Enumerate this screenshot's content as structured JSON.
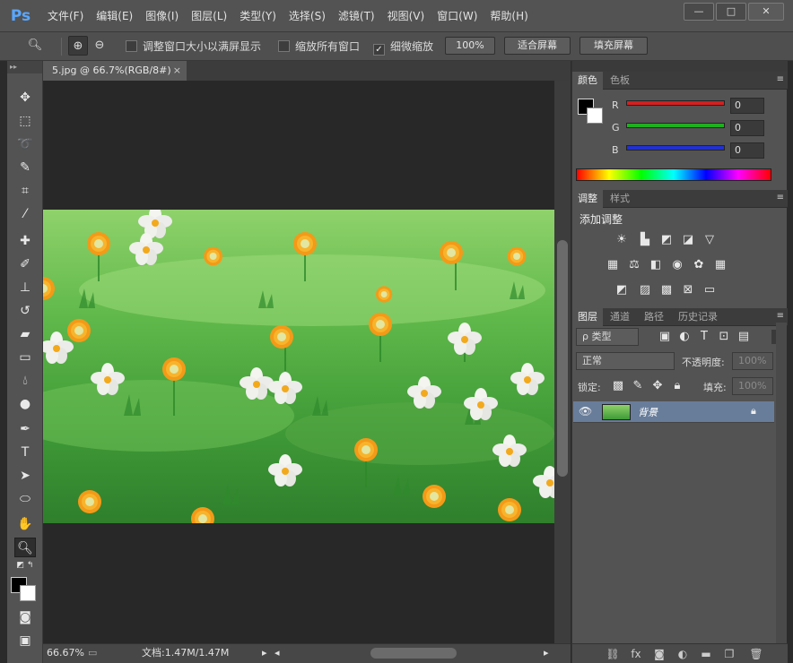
{
  "app": {
    "logo": "Ps"
  },
  "menu": [
    "文件(F)",
    "编辑(E)",
    "图像(I)",
    "图层(L)",
    "类型(Y)",
    "选择(S)",
    "滤镜(T)",
    "视图(V)",
    "窗口(W)",
    "帮助(H)"
  ],
  "window_controls": {
    "minimize": "—",
    "maximize": "□",
    "close": "✕"
  },
  "options": {
    "fit_window_label": "调整窗口大小以满屏显示",
    "fit_window_checked": false,
    "zoom_all_label": "缩放所有窗口",
    "zoom_all_checked": false,
    "scrubby_label": "细微缩放",
    "scrubby_checked": true,
    "percent_button": "100%",
    "fit_screen_button": "适合屏幕",
    "fill_screen_button": "填充屏幕"
  },
  "document": {
    "tab_title": "5.jpg @ 66.7%(RGB/8#)",
    "tab_close": "×"
  },
  "status": {
    "zoom": "66.67%",
    "doc_size": "文档:1.47M/1.47M"
  },
  "color_panel": {
    "tabs": [
      "颜色",
      "色板"
    ],
    "channels": [
      {
        "label": "R",
        "value": "0",
        "color": "#e02020"
      },
      {
        "label": "G",
        "value": "0",
        "color": "#20c020"
      },
      {
        "label": "B",
        "value": "0",
        "color": "#2040e0"
      }
    ]
  },
  "adjustments_panel": {
    "tabs": [
      "调整",
      "样式"
    ],
    "title": "添加调整"
  },
  "layers_panel": {
    "tabs": [
      "图层",
      "通道",
      "路径",
      "历史记录"
    ],
    "filter_kind": "ρ 类型",
    "blend_mode": "正常",
    "opacity_label": "不透明度:",
    "opacity_value": "100%",
    "lock_label": "锁定:",
    "fill_label": "填充:",
    "fill_value": "100%",
    "layers": [
      {
        "name": "背景",
        "visible": true,
        "locked": true
      }
    ]
  },
  "colors": {
    "accent_selected_layer": "#687d9a",
    "ps_blue": "#5aa7ff"
  }
}
